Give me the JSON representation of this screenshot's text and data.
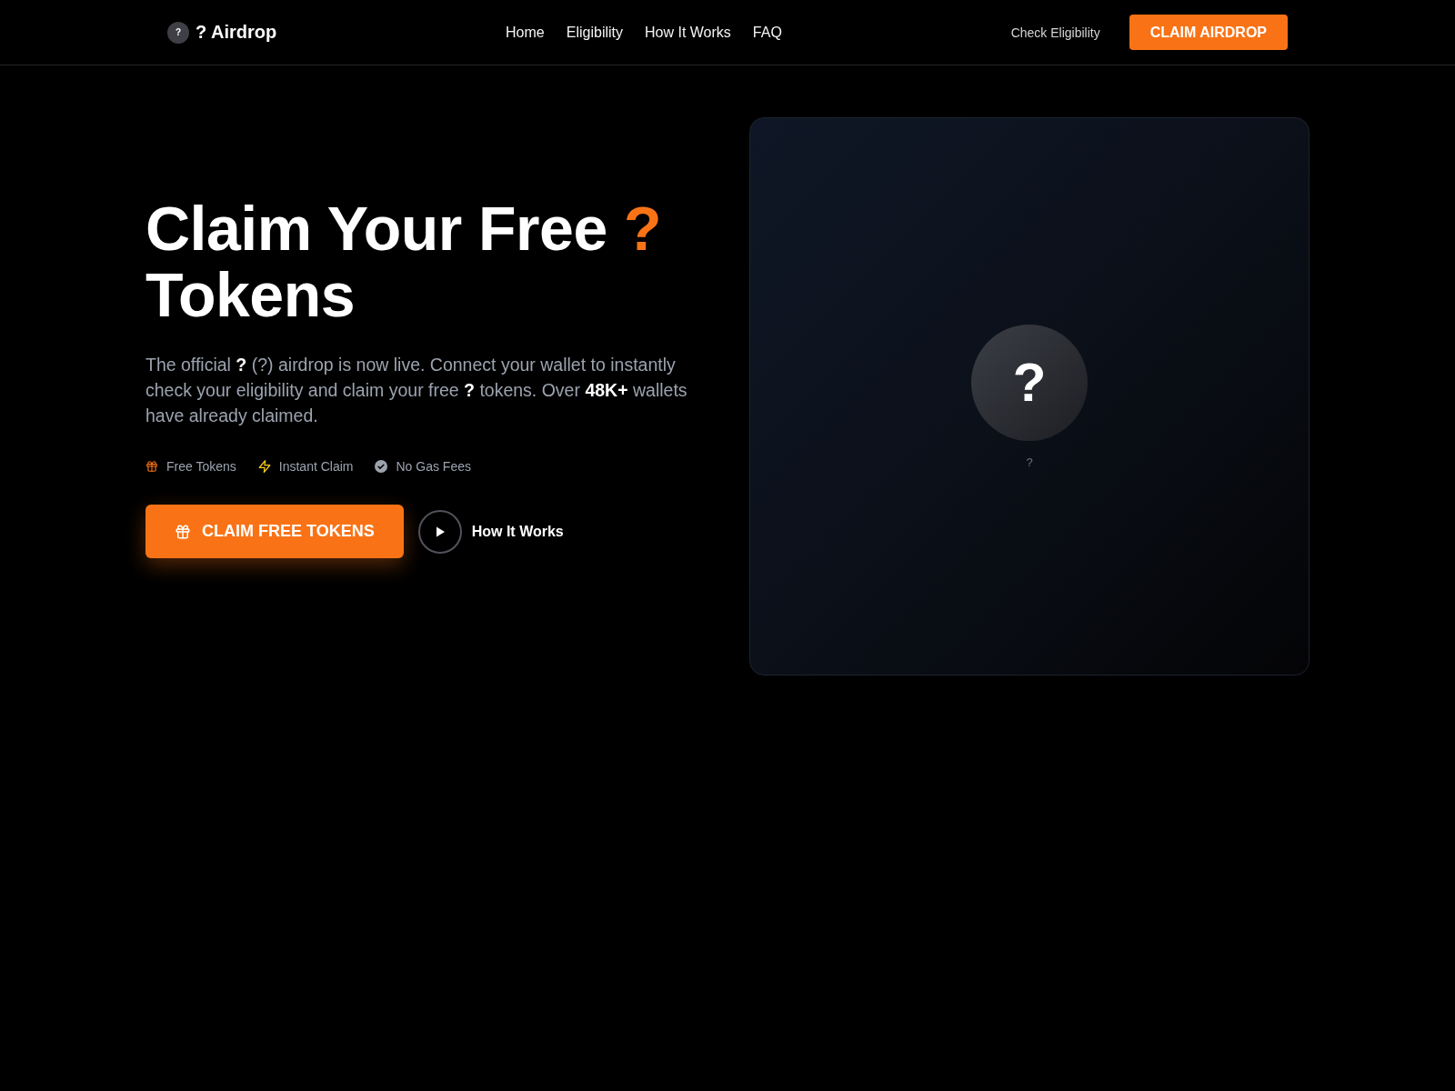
{
  "header": {
    "logo": {
      "mark": "?",
      "name": "? Airdrop"
    },
    "nav": [
      "Home",
      "Eligibility",
      "How It Works",
      "FAQ"
    ],
    "link": "Check Eligibility",
    "button": "CLAIM AIRDROP"
  },
  "hero": {
    "heading": {
      "text": "Claim Your Free",
      "accent": "?",
      "line_2": "Tokens"
    },
    "description": "The official **?** (?) airdrop is now live. Connect your wallet to instantly check your eligibility and claim your free **?** tokens. Over **48K+** wallets have already claimed.",
    "features": [
      {
        "kind": "gift",
        "label": "Free Tokens"
      },
      {
        "kind": "bolt",
        "label": "Instant Claim"
      },
      {
        "kind": "check",
        "label": "No Gas Fees"
      }
    ],
    "primary_button": "CLAIM FREE TOKENS",
    "secondary_link": "How It Works"
  },
  "token_card": {
    "symbol": "?",
    "label": "?"
  }
}
